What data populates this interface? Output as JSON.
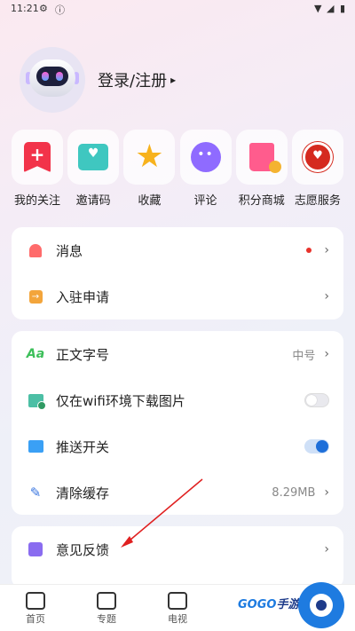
{
  "status_bar": {
    "time": "11:21",
    "icons": [
      "settings-icon",
      "alert-icon",
      "wifi-icon",
      "signal-icon",
      "battery-icon"
    ]
  },
  "profile": {
    "login_label": "登录/注册",
    "arrow": "▸"
  },
  "quick_links": [
    {
      "label": "我的关注",
      "icon": "bookmark-plus-icon"
    },
    {
      "label": "邀请码",
      "icon": "envelope-heart-icon"
    },
    {
      "label": "收藏",
      "icon": "star-icon"
    },
    {
      "label": "评论",
      "icon": "comment-icon"
    },
    {
      "label": "积分商城",
      "icon": "shopping-bag-icon"
    },
    {
      "label": "志愿服务",
      "icon": "volunteer-badge-icon"
    }
  ],
  "menu_group_1": [
    {
      "label": "消息",
      "icon": "bell-icon",
      "has_dot": true
    },
    {
      "label": "入驻申请",
      "icon": "enter-icon"
    }
  ],
  "menu_group_2": [
    {
      "label": "正文字号",
      "icon": "font-size-icon",
      "value": "中号",
      "glyph": "Aa"
    },
    {
      "label": "仅在wifi环境下载图片",
      "icon": "image-download-icon",
      "toggle": "off"
    },
    {
      "label": "推送开关",
      "icon": "push-icon",
      "toggle": "on"
    },
    {
      "label": "清除缓存",
      "icon": "broom-icon",
      "value": "8.29MB"
    }
  ],
  "menu_group_3": [
    {
      "label": "意见反馈",
      "icon": "feedback-icon"
    }
  ],
  "chevron": "›",
  "tab_bar": [
    {
      "label": "首页",
      "icon": "home-icon"
    },
    {
      "label": "专题",
      "icon": "topic-icon"
    },
    {
      "label": "电视",
      "icon": "tv-icon"
    }
  ],
  "watermark": {
    "text": "GOGO",
    "sub": "手游网"
  },
  "colors": {
    "accent": "#1e7be0",
    "notification_dot": "#e8322b",
    "annotation_arrow": "#e02020"
  }
}
